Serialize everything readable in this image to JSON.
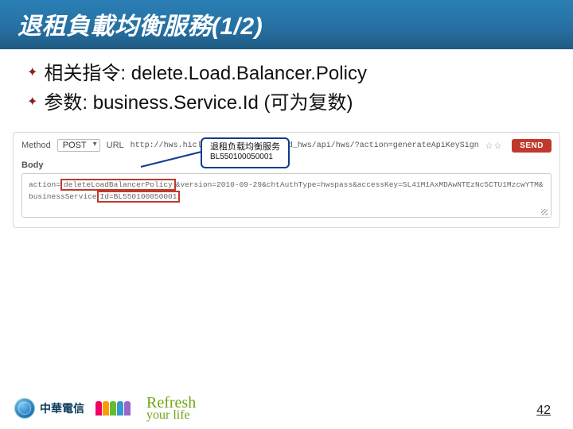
{
  "title": "退租負載均衡服務(1/2)",
  "bullets": [
    {
      "label": "相关指令: delete.Load.Balancer.Policy"
    },
    {
      "label": "参数: business.Service.Id  (可为复数)"
    }
  ],
  "panel": {
    "methodLabel": "Method",
    "methodValue": "POST",
    "urlLabel": "URL",
    "urlValue": "http://hws.hicloud.hinet.net/cloud_hws/api/hws/?action=generateApiKeySignature&chtAuthType=",
    "stars": "☆☆",
    "sendLabel": "SEND",
    "callout": {
      "line1": "退租负载均衡服务",
      "line2": "BL550100050001"
    },
    "bodyLabel": "Body",
    "bodyLine1a": "action=",
    "bodyLine1b": "deleteLoadBalancerPolicy",
    "bodyLine1c": "&version=2010-09-29&chtAuthType=hwspass&accessKey=SL41M1AxMDAwNTEzNc5CTU1MzcwYTM&",
    "bodyLine2a": "businessService",
    "bodyLine2b": "Id=BL550100050001"
  },
  "footer": {
    "brand": "中華電信",
    "refresh1": "Refresh",
    "refresh2": "your life",
    "page": "42"
  }
}
